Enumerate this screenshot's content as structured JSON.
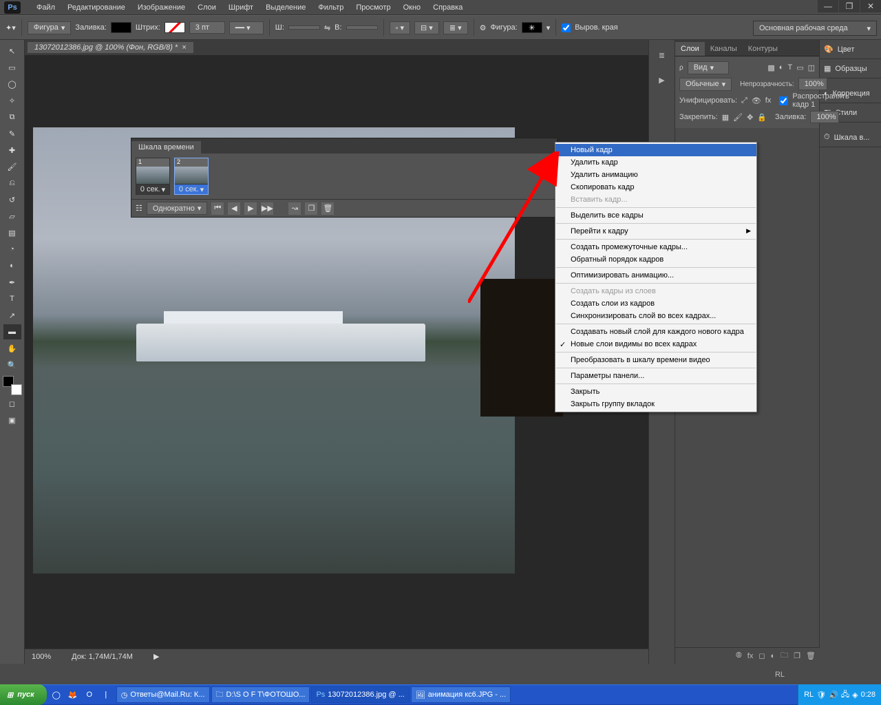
{
  "menubar": {
    "items": [
      "Файл",
      "Редактирование",
      "Изображение",
      "Слои",
      "Шрифт",
      "Выделение",
      "Фильтр",
      "Просмотр",
      "Окно",
      "Справка"
    ]
  },
  "workspace": {
    "label": "Основная рабочая среда"
  },
  "options": {
    "shape": "Фигура",
    "fill": "Заливка:",
    "stroke": "Штрих:",
    "stroke_width": "3 пт",
    "w": "Ш:",
    "h": "В:",
    "shape2": "Фигура:",
    "align_edges": "Выров. края"
  },
  "doc": {
    "tab": "13072012386.jpg @ 100% (Фон, RGB/8) *",
    "zoom": "100%",
    "docsize": "Док:  1,74M/1,74M"
  },
  "layers_panel": {
    "tabs": [
      "Слои",
      "Каналы",
      "Контуры"
    ],
    "kind": "Вид",
    "blend": "Обычные",
    "opacity_label": "Непрозрачность:",
    "opacity": "100%",
    "unify": "Унифицировать:",
    "propagate": "Распространять кадр 1",
    "lock": "Закрепить:",
    "fill_label": "Заливка:",
    "fill": "100%"
  },
  "right_dock": {
    "color": "Цвет",
    "swatches": "Образцы",
    "adjust": "Коррекция",
    "styles": "Стили",
    "timeline": "Шкала в..."
  },
  "timeline": {
    "title": "Шкала времени",
    "frame1_num": "1",
    "frame2_num": "2",
    "frame_caption": "0 сек.",
    "loop": "Однократно"
  },
  "context": {
    "items": [
      {
        "t": "Новый кадр",
        "hi": true
      },
      {
        "t": "Удалить кадр"
      },
      {
        "t": "Удалить анимацию"
      },
      {
        "t": "Скопировать кадр"
      },
      {
        "t": "Вставить кадр...",
        "dis": true
      },
      {
        "sep": true
      },
      {
        "t": "Выделить все кадры"
      },
      {
        "sep": true
      },
      {
        "t": "Перейти к кадру",
        "arrow": true
      },
      {
        "sep": true
      },
      {
        "t": "Создать промежуточные кадры..."
      },
      {
        "t": "Обратный порядок кадров"
      },
      {
        "sep": true
      },
      {
        "t": "Оптимизировать анимацию..."
      },
      {
        "sep": true
      },
      {
        "t": "Создать кадры из слоев",
        "dis": true
      },
      {
        "t": "Создать слои из кадров"
      },
      {
        "t": "Синхронизировать слой во всех кадрах..."
      },
      {
        "sep": true
      },
      {
        "t": "Создавать новый слой для каждого нового кадра"
      },
      {
        "t": "Новые слои видимы во всех кадрах",
        "check": true
      },
      {
        "sep": true
      },
      {
        "t": "Преобразовать в шкалу времени видео"
      },
      {
        "sep": true
      },
      {
        "t": "Параметры панели..."
      },
      {
        "sep": true
      },
      {
        "t": "Закрыть"
      },
      {
        "t": "Закрыть группу вкладок"
      }
    ]
  },
  "taskbar": {
    "start": "пуск",
    "items": [
      "Ответы@Mail.Ru: К...",
      "D:\\S O F T\\ФОТОШО...",
      "13072012386.jpg @ ...",
      "анимация кс6.JPG - ..."
    ],
    "lang": "RL",
    "clock": "0:28"
  },
  "lang_ind": "RL"
}
